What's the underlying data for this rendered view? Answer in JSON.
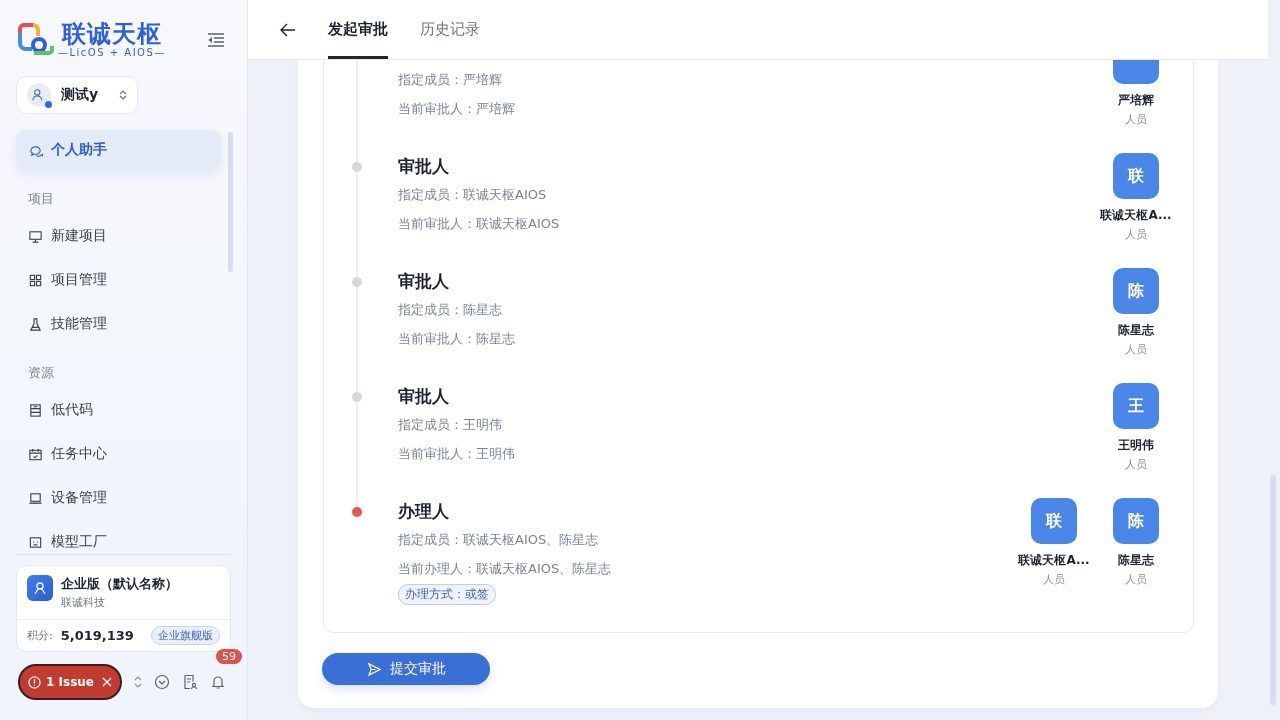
{
  "brand": {
    "name": "联诚天枢",
    "tagline": "—LicOS + AIOS—"
  },
  "workspace": {
    "name": "测试y"
  },
  "nav": [
    {
      "kind": "item",
      "label": "个人助手",
      "selected": true
    },
    {
      "kind": "section",
      "label": "项目"
    },
    {
      "kind": "item",
      "label": "新建项目",
      "selected": false
    },
    {
      "kind": "item",
      "label": "项目管理",
      "selected": false
    },
    {
      "kind": "item",
      "label": "技能管理",
      "selected": false
    },
    {
      "kind": "section",
      "label": "资源"
    },
    {
      "kind": "item",
      "label": "低代码",
      "selected": false
    },
    {
      "kind": "item",
      "label": "任务中心",
      "selected": false
    },
    {
      "kind": "item",
      "label": "设备管理",
      "selected": false
    },
    {
      "kind": "item",
      "label": "模型工厂",
      "selected": false
    }
  ],
  "org": {
    "name": "企业版（默认名称）",
    "company": "联诚科技",
    "points_label": "积分:",
    "points": "5,019,139",
    "plan": "企业旗舰版"
  },
  "issue": {
    "label": "1 Issue"
  },
  "notifications": {
    "count": "59"
  },
  "tabs": [
    {
      "label": "发起审批",
      "selected": true
    },
    {
      "label": "历史记录",
      "selected": false
    }
  ],
  "steps": [
    {
      "lines": [
        "指定成员：严培辉",
        "当前审批人：严培辉"
      ],
      "people": [
        {
          "name": "严培辉",
          "role": "人员"
        }
      ]
    },
    {
      "color": "#d5d8de",
      "title": "审批人",
      "lines": [
        "指定成员：联诚天枢AIOS",
        "当前审批人：联诚天枢AIOS"
      ],
      "people": [
        {
          "avatar": "联",
          "name": "联诚天枢A...",
          "role": "人员"
        }
      ]
    },
    {
      "color": "#d5d8de",
      "title": "审批人",
      "lines": [
        "指定成员：陈星志",
        "当前审批人：陈星志"
      ],
      "people": [
        {
          "avatar": "陈",
          "name": "陈星志",
          "role": "人员"
        }
      ]
    },
    {
      "color": "#d5d8de",
      "title": "审批人",
      "lines": [
        "指定成员：王明伟",
        "当前审批人：王明伟"
      ],
      "people": [
        {
          "avatar": "王",
          "name": "王明伟",
          "role": "人员"
        }
      ]
    },
    {
      "color": "#e8594a",
      "title": "办理人",
      "lines": [
        "指定成员：联诚天枢AIOS、陈星志",
        "当前办理人：联诚天枢AIOS、陈星志"
      ],
      "tag": "办理方式：或签",
      "people": [
        {
          "avatar": "联",
          "name": "联诚天枢A...",
          "role": "人员"
        },
        {
          "avatar": "陈",
          "name": "陈星志",
          "role": "人员"
        }
      ]
    }
  ],
  "submit": {
    "label": "提交审批"
  }
}
